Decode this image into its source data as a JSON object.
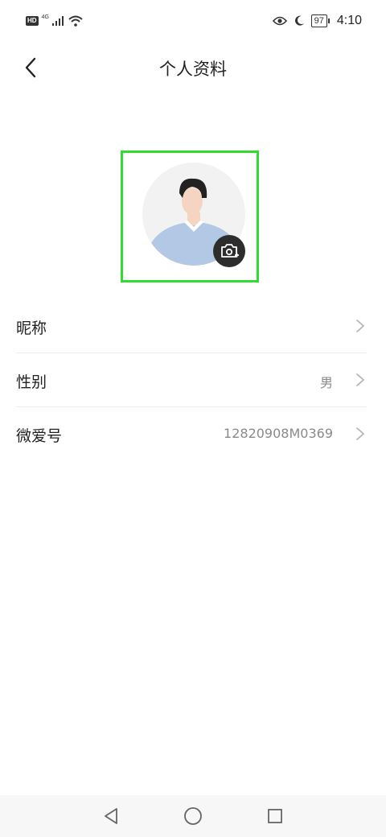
{
  "status_bar": {
    "hd_badge": "HD",
    "network_label": "4G",
    "battery": "97",
    "time": "4:10",
    "icons": [
      "signal-icon",
      "wifi-icon",
      "eye-icon",
      "moon-icon",
      "battery-icon"
    ]
  },
  "header": {
    "title": "个人资料",
    "back_icon": "chevron-left-icon"
  },
  "avatar": {
    "camera_icon": "camera-add-icon",
    "highlight_color": "#2fdc2f"
  },
  "rows": [
    {
      "label": "昵称",
      "value": ""
    },
    {
      "label": "性别",
      "value": "男"
    },
    {
      "label": "微爱号",
      "value": "12820908M0369"
    }
  ],
  "nav_bar": {
    "icons": [
      "back-triangle-icon",
      "home-circle-icon",
      "recents-square-icon"
    ]
  }
}
